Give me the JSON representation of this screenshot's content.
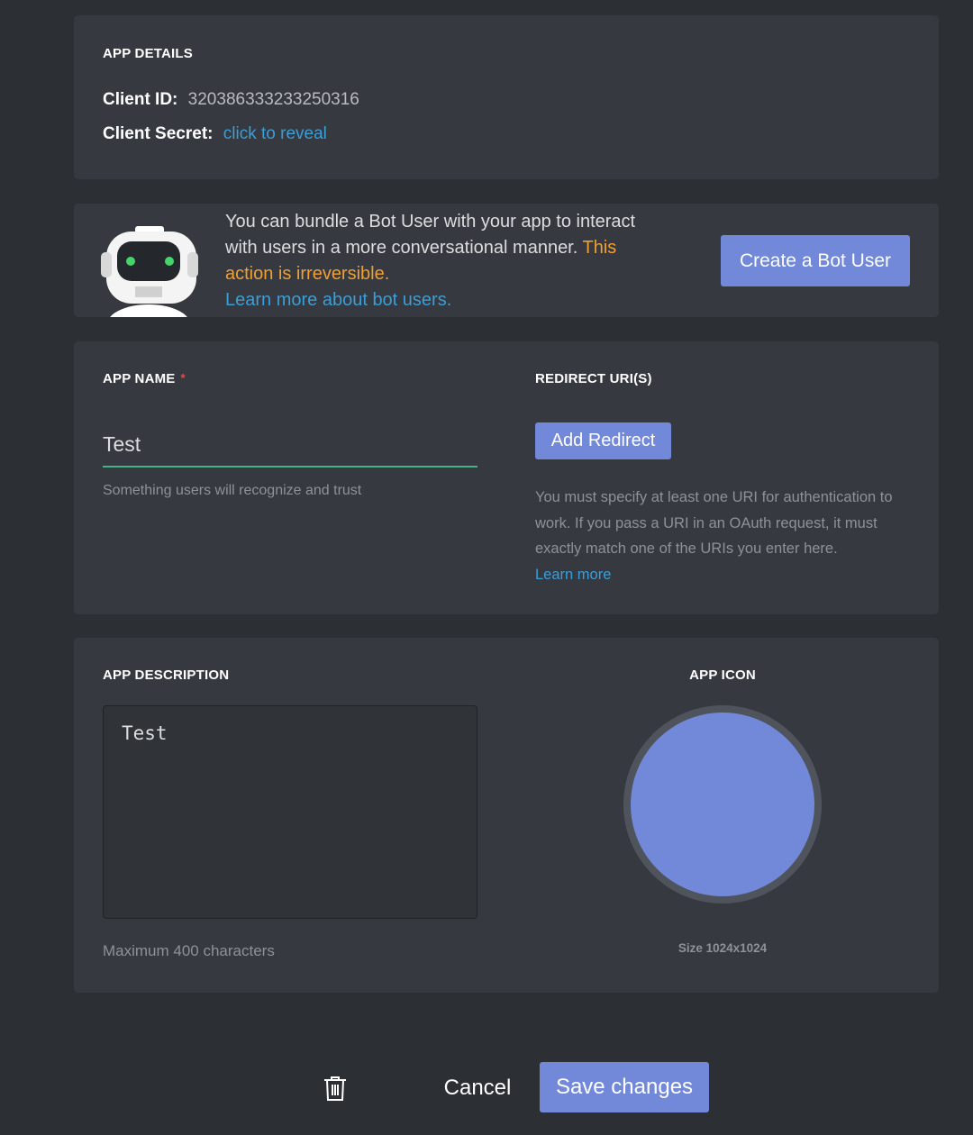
{
  "app_details": {
    "heading": "APP DETAILS",
    "client_id_label": "Client ID:",
    "client_id_value": "320386333233250316",
    "client_secret_label": "Client Secret:",
    "client_secret_link": "click to reveal"
  },
  "bot": {
    "text": "You can bundle a Bot User with your app to interact with users in a more conversational manner.",
    "warning": "This action is irreversible.",
    "learn_more": "Learn more about bot users.",
    "button_label": "Create a Bot User"
  },
  "app_name": {
    "label": "APP NAME",
    "required_marker": "*",
    "value": "Test",
    "hint": "Something users will recognize and trust"
  },
  "redirect": {
    "label": "REDIRECT URI(S)",
    "button_label": "Add Redirect",
    "help_text": "You must specify at least one URI for authentication to work. If you pass a URI in an OAuth request, it must exactly match one of the URIs you enter here.",
    "learn_more": "Learn more"
  },
  "description": {
    "label": "APP DESCRIPTION",
    "value": "Test",
    "hint": "Maximum 400 characters"
  },
  "icon": {
    "label": "APP ICON",
    "size_hint": "Size 1024x1024",
    "color": "#7289da"
  },
  "footer": {
    "cancel_label": "Cancel",
    "save_label": "Save changes"
  },
  "colors": {
    "blurple": "#7289da",
    "link": "#3a9ed7",
    "warning": "#f0a030",
    "success_underline": "#43b581"
  }
}
